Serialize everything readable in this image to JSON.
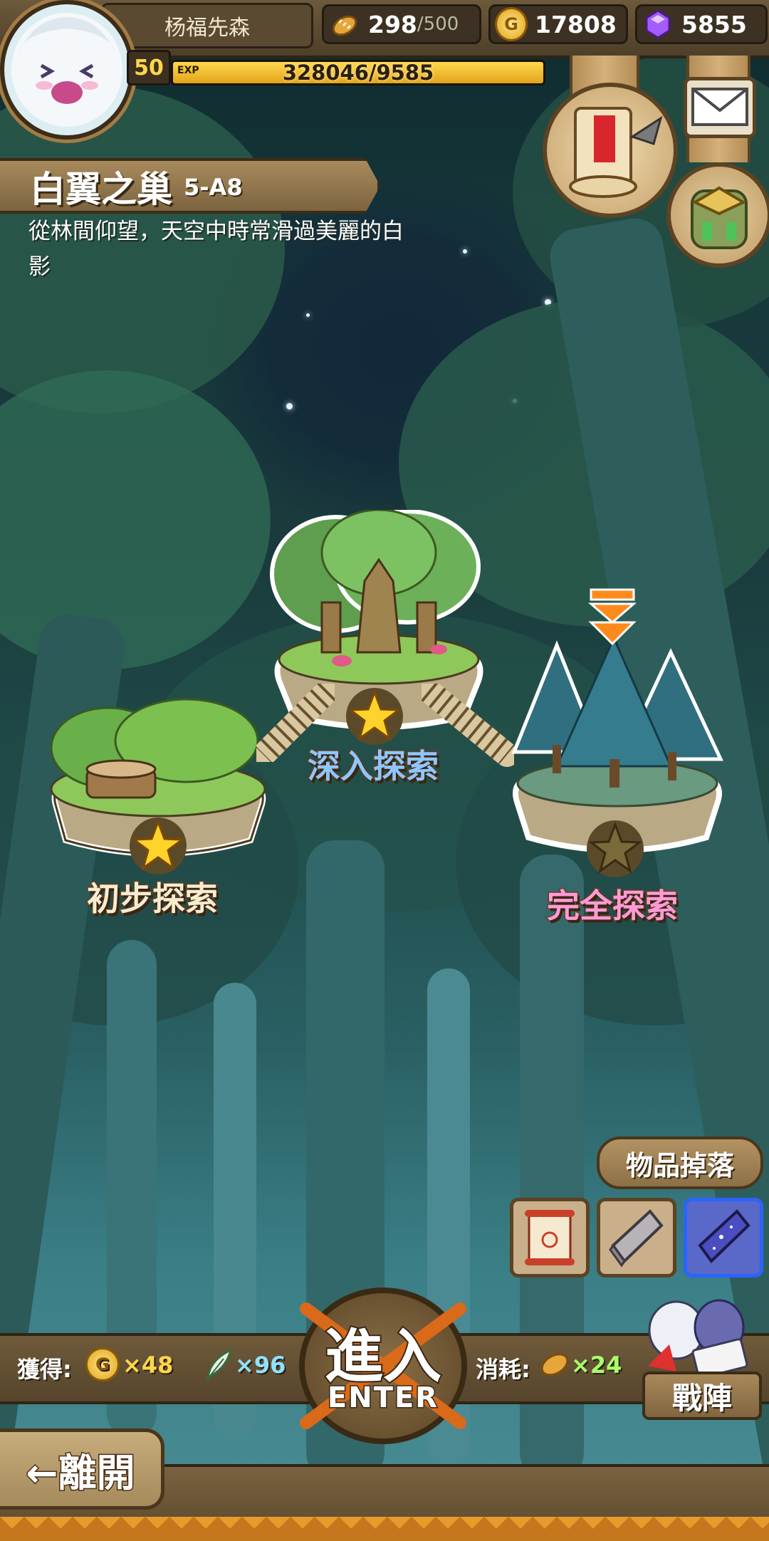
{
  "hud": {
    "player_name": "杨福先森",
    "level": "50",
    "exp_label": "EXP",
    "exp_text": "328046/9585",
    "stamina": {
      "value": "298",
      "max": "/500",
      "icon": "bread-icon"
    },
    "gold": {
      "value": "17808",
      "icon": "gold-coin-icon"
    },
    "gems": {
      "value": "5855",
      "icon": "purple-gem-icon"
    }
  },
  "side_buttons": {
    "quest": "quest-scroll-icon",
    "mail": "mail-envelope-icon",
    "bag": "backpack-icon"
  },
  "stage": {
    "title": "白翼之巢",
    "code": "5-A8",
    "description": "從林間仰望，天空中時常滑過美麗的白影"
  },
  "islands": [
    {
      "label": "初步探索",
      "star_earned": true
    },
    {
      "label": "深入探索",
      "star_earned": true
    },
    {
      "label": "完全探索",
      "star_earned": false,
      "current": true
    }
  ],
  "drops": {
    "title": "物品掉落",
    "items": [
      "scroll-item-icon",
      "stone-slab-item-icon",
      "crystal-slab-item-icon"
    ]
  },
  "bottom": {
    "gain_label": "獲得:",
    "gold_reward": "×48",
    "feather_reward": "×96",
    "cost_label": "消耗:",
    "stamina_cost": "×24",
    "enter_main": "進入",
    "enter_sub": "ENTER",
    "team_label": "戰陣",
    "leave_label": "←離開"
  },
  "colors": {
    "gold": "#ffd64a",
    "reward_gold_text": "#ffd64a",
    "reward_feather_text": "#8fe3ff",
    "cost_text": "#a8ff6a",
    "label_blue": "#8fc6ff",
    "label_pink": "#ff9ad6"
  }
}
